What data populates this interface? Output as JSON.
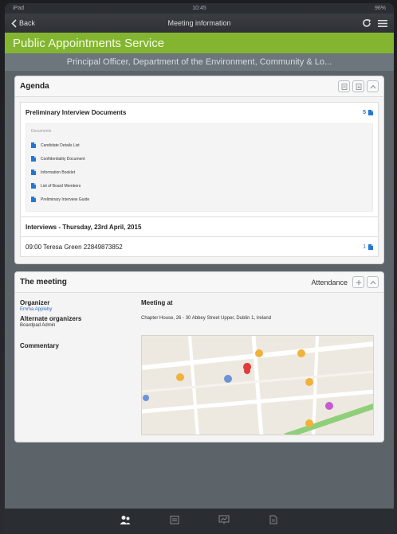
{
  "status": {
    "left": "iPad",
    "time": "10:45",
    "battery": "96%"
  },
  "nav": {
    "back_label": "Back",
    "title": "Meeting information",
    "refresh_icon": "refresh-icon",
    "menu_icon": "menu-icon"
  },
  "brand": {
    "title": "Public Appointments Service",
    "color": "#84b531"
  },
  "subheader": "Principal Officer, Department of the Environment, Community & Lo...",
  "agenda": {
    "title": "Agenda",
    "section_title": "Preliminary Interview Documents",
    "section_count": "5",
    "documents_header": "Documents",
    "documents": [
      "Candidate Details List",
      "Confidentiality Document",
      "Information Booklet",
      "List of Board Members",
      "Preliminary Interview Guide"
    ],
    "interviews_title": "Interviews - Thursday, 23rd April, 2015",
    "interview_row": "09:00 Teresa Green 22849873852",
    "interview_count": "1"
  },
  "meeting": {
    "title": "The meeting",
    "attendance_label": "Attendance",
    "organizer_label": "Organizer",
    "organizer_name": "Emma Appleby",
    "alt_organizers_label": "Alternate organizers",
    "alt_organizer_name": "Boardpad Admin",
    "commentary_label": "Commentary",
    "meeting_at_label": "Meeting at",
    "address": "Chapter House, 26 - 30 Abbey Street Upper, Dublin 1, Ireland"
  },
  "tabs": [
    "people-icon",
    "calendar-icon",
    "presentation-icon",
    "document-icon"
  ]
}
